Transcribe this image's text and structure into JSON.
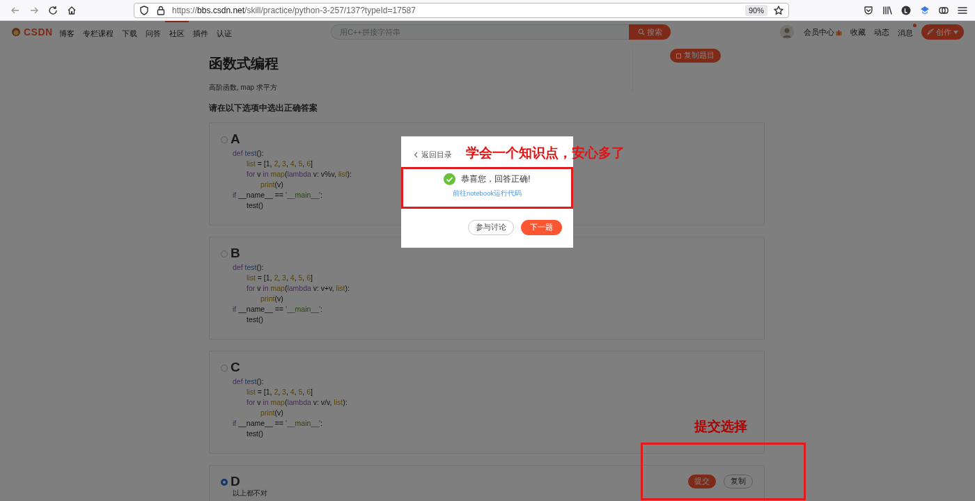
{
  "browser": {
    "url": {
      "scheme": "https://",
      "host": "bbs.csdn.net",
      "path": "/skill/practice/python-3-257/137?typeId=17587"
    },
    "zoom": "90%"
  },
  "site_nav": {
    "logo": "CSDN",
    "items": [
      {
        "label": "博客",
        "selected": false
      },
      {
        "label": "专栏课程",
        "selected": false
      },
      {
        "label": "下载",
        "selected": false
      },
      {
        "label": "问答",
        "selected": false
      },
      {
        "label": "社区",
        "selected": true
      },
      {
        "label": "插件",
        "selected": false
      },
      {
        "label": "认证",
        "selected": false
      }
    ],
    "search": {
      "placeholder": "用C++拼接字符串",
      "button": "搜索"
    },
    "member_center": "会员中心",
    "links": [
      "收藏",
      "动态"
    ],
    "messages": {
      "label": "消息",
      "unread": true
    },
    "create_button": "创作"
  },
  "question": {
    "title": "函数式编程",
    "tags": "高阶函数, map 求平方",
    "prompt": "请在以下选项中选出正确答案",
    "copy_button": "复制题目",
    "options": [
      {
        "letter": "A",
        "selected": false,
        "code": [
          {
            "tokens": [
              {
                "kind": "kw",
                "text": "def"
              },
              {
                "kind": "fn",
                "text": " test"
              },
              {
                "kind": "txt",
                "text": "():"
              }
            ],
            "children": [
              {
                "tokens": [
                  {
                    "kind": "bi",
                    "text": "list"
                  },
                  {
                    "kind": "txt",
                    "text": " = [1, "
                  },
                  {
                    "kind": "bi",
                    "text": "2"
                  },
                  {
                    "kind": "txt",
                    "text": ", "
                  },
                  {
                    "kind": "bi",
                    "text": "3"
                  },
                  {
                    "kind": "txt",
                    "text": ", "
                  },
                  {
                    "kind": "bi",
                    "text": "4"
                  },
                  {
                    "kind": "txt",
                    "text": ", "
                  },
                  {
                    "kind": "bi",
                    "text": "5"
                  },
                  {
                    "kind": "txt",
                    "text": ", "
                  },
                  {
                    "kind": "bi",
                    "text": "6"
                  },
                  {
                    "kind": "txt",
                    "text": "]"
                  }
                ]
              },
              {
                "tokens": [
                  {
                    "kind": "kw",
                    "text": "for"
                  },
                  {
                    "kind": "txt",
                    "text": " v "
                  },
                  {
                    "kind": "kw",
                    "text": "in"
                  },
                  {
                    "kind": "bi",
                    "text": " map"
                  },
                  {
                    "kind": "txt",
                    "text": "("
                  },
                  {
                    "kind": "kw",
                    "text": "lambda"
                  },
                  {
                    "kind": "txt",
                    "text": " v: v%v, "
                  },
                  {
                    "kind": "bi",
                    "text": "list"
                  },
                  {
                    "kind": "txt",
                    "text": "):"
                  }
                ],
                "children": [
                  {
                    "tokens": [
                      {
                        "kind": "bi",
                        "text": "print"
                      },
                      {
                        "kind": "txt",
                        "text": "(v)"
                      }
                    ]
                  }
                ]
              }
            ]
          },
          {
            "tokens": [
              {
                "kind": "kw",
                "text": "if"
              },
              {
                "kind": "txt",
                "text": " __name__ == "
              },
              {
                "kind": "str",
                "text": "'__main__'"
              },
              {
                "kind": "txt",
                "text": ":"
              }
            ],
            "children": [
              {
                "tokens": [
                  {
                    "kind": "txt",
                    "text": "test()"
                  }
                ]
              }
            ]
          }
        ]
      },
      {
        "letter": "B",
        "selected": false,
        "code": [
          {
            "tokens": [
              {
                "kind": "kw",
                "text": "def"
              },
              {
                "kind": "fn",
                "text": " test"
              },
              {
                "kind": "txt",
                "text": "():"
              }
            ],
            "children": [
              {
                "tokens": [
                  {
                    "kind": "bi",
                    "text": "list"
                  },
                  {
                    "kind": "txt",
                    "text": " = [1, "
                  },
                  {
                    "kind": "bi",
                    "text": "2"
                  },
                  {
                    "kind": "txt",
                    "text": ", "
                  },
                  {
                    "kind": "bi",
                    "text": "3"
                  },
                  {
                    "kind": "txt",
                    "text": ", "
                  },
                  {
                    "kind": "bi",
                    "text": "4"
                  },
                  {
                    "kind": "txt",
                    "text": ", "
                  },
                  {
                    "kind": "bi",
                    "text": "5"
                  },
                  {
                    "kind": "txt",
                    "text": ", "
                  },
                  {
                    "kind": "bi",
                    "text": "6"
                  },
                  {
                    "kind": "txt",
                    "text": "]"
                  }
                ]
              },
              {
                "tokens": [
                  {
                    "kind": "kw",
                    "text": "for"
                  },
                  {
                    "kind": "txt",
                    "text": " v "
                  },
                  {
                    "kind": "kw",
                    "text": "in"
                  },
                  {
                    "kind": "bi",
                    "text": " map"
                  },
                  {
                    "kind": "txt",
                    "text": "("
                  },
                  {
                    "kind": "kw",
                    "text": "lambda"
                  },
                  {
                    "kind": "txt",
                    "text": " v: v+v, "
                  },
                  {
                    "kind": "bi",
                    "text": "list"
                  },
                  {
                    "kind": "txt",
                    "text": "):"
                  }
                ],
                "children": [
                  {
                    "tokens": [
                      {
                        "kind": "bi",
                        "text": "print"
                      },
                      {
                        "kind": "txt",
                        "text": "(v)"
                      }
                    ]
                  }
                ]
              }
            ]
          },
          {
            "tokens": [
              {
                "kind": "kw",
                "text": "if"
              },
              {
                "kind": "txt",
                "text": " __name__ == "
              },
              {
                "kind": "str",
                "text": "'__main__'"
              },
              {
                "kind": "txt",
                "text": ":"
              }
            ],
            "children": [
              {
                "tokens": [
                  {
                    "kind": "txt",
                    "text": "test()"
                  }
                ]
              }
            ]
          }
        ]
      },
      {
        "letter": "C",
        "selected": false,
        "code": [
          {
            "tokens": [
              {
                "kind": "kw",
                "text": "def"
              },
              {
                "kind": "fn",
                "text": " test"
              },
              {
                "kind": "txt",
                "text": "():"
              }
            ],
            "children": [
              {
                "tokens": [
                  {
                    "kind": "bi",
                    "text": "list"
                  },
                  {
                    "kind": "txt",
                    "text": " = [1, "
                  },
                  {
                    "kind": "bi",
                    "text": "2"
                  },
                  {
                    "kind": "txt",
                    "text": ", "
                  },
                  {
                    "kind": "bi",
                    "text": "3"
                  },
                  {
                    "kind": "txt",
                    "text": ", "
                  },
                  {
                    "kind": "bi",
                    "text": "4"
                  },
                  {
                    "kind": "txt",
                    "text": ", "
                  },
                  {
                    "kind": "bi",
                    "text": "5"
                  },
                  {
                    "kind": "txt",
                    "text": ", "
                  },
                  {
                    "kind": "bi",
                    "text": "6"
                  },
                  {
                    "kind": "txt",
                    "text": "]"
                  }
                ]
              },
              {
                "tokens": [
                  {
                    "kind": "kw",
                    "text": "for"
                  },
                  {
                    "kind": "txt",
                    "text": " v "
                  },
                  {
                    "kind": "kw",
                    "text": "in"
                  },
                  {
                    "kind": "bi",
                    "text": " map"
                  },
                  {
                    "kind": "txt",
                    "text": "("
                  },
                  {
                    "kind": "kw",
                    "text": "lambda"
                  },
                  {
                    "kind": "txt",
                    "text": " v: v/v, "
                  },
                  {
                    "kind": "bi",
                    "text": "list"
                  },
                  {
                    "kind": "txt",
                    "text": "):"
                  }
                ],
                "children": [
                  {
                    "tokens": [
                      {
                        "kind": "bi",
                        "text": "print"
                      },
                      {
                        "kind": "txt",
                        "text": "(v)"
                      }
                    ]
                  }
                ]
              }
            ]
          },
          {
            "tokens": [
              {
                "kind": "kw",
                "text": "if"
              },
              {
                "kind": "txt",
                "text": " __name__ == "
              },
              {
                "kind": "str",
                "text": "'__main__'"
              },
              {
                "kind": "txt",
                "text": ":"
              }
            ],
            "children": [
              {
                "tokens": [
                  {
                    "kind": "txt",
                    "text": "test()"
                  }
                ]
              }
            ]
          }
        ]
      },
      {
        "letter": "D",
        "selected": true,
        "text": "以上都不对"
      }
    ],
    "submit_button": "提交",
    "copy_code_button": "复制"
  },
  "dialog": {
    "back": "返回目录",
    "message": "恭喜您，回答正确!",
    "link": "前往notebook运行代码",
    "buttons": [
      {
        "label": "参与讨论",
        "kind": "secondary"
      },
      {
        "label": "下一题",
        "kind": "primary"
      }
    ]
  },
  "annotations": [
    "学会一个知识点，安心多了",
    "提交选择"
  ]
}
